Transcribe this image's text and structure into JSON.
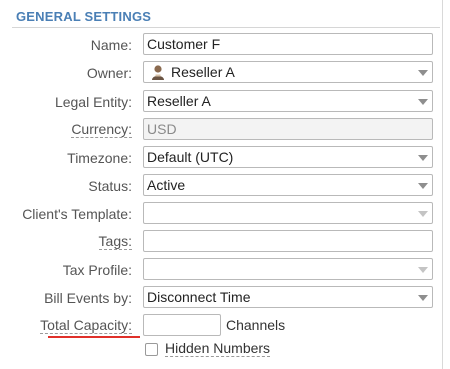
{
  "section": {
    "title": "GENERAL SETTINGS"
  },
  "fields": {
    "name": {
      "label": "Name:",
      "value": "Customer F"
    },
    "owner": {
      "label": "Owner:",
      "value": "Reseller A",
      "icon": "user-avatar-icon"
    },
    "legal_entity": {
      "label": "Legal Entity:",
      "value": "Reseller A"
    },
    "currency": {
      "label": "Currency:",
      "value": "USD"
    },
    "timezone": {
      "label": "Timezone:",
      "value": "Default (UTC)"
    },
    "status": {
      "label": "Status:",
      "value": "Active"
    },
    "clients_template": {
      "label": "Client's Template:",
      "value": ""
    },
    "tags": {
      "label": "Tags:",
      "value": ""
    },
    "tax_profile": {
      "label": "Tax Profile:",
      "value": ""
    },
    "bill_events_by": {
      "label": "Bill Events by:",
      "value": "Disconnect Time"
    },
    "total_capacity": {
      "label": "Total Capacity:",
      "value": "",
      "unit": "Channels"
    },
    "hidden_numbers": {
      "label": "Hidden Numbers",
      "checked": false
    }
  },
  "colors": {
    "accent": "#4a7fb5",
    "highlight": "#e0302a"
  }
}
